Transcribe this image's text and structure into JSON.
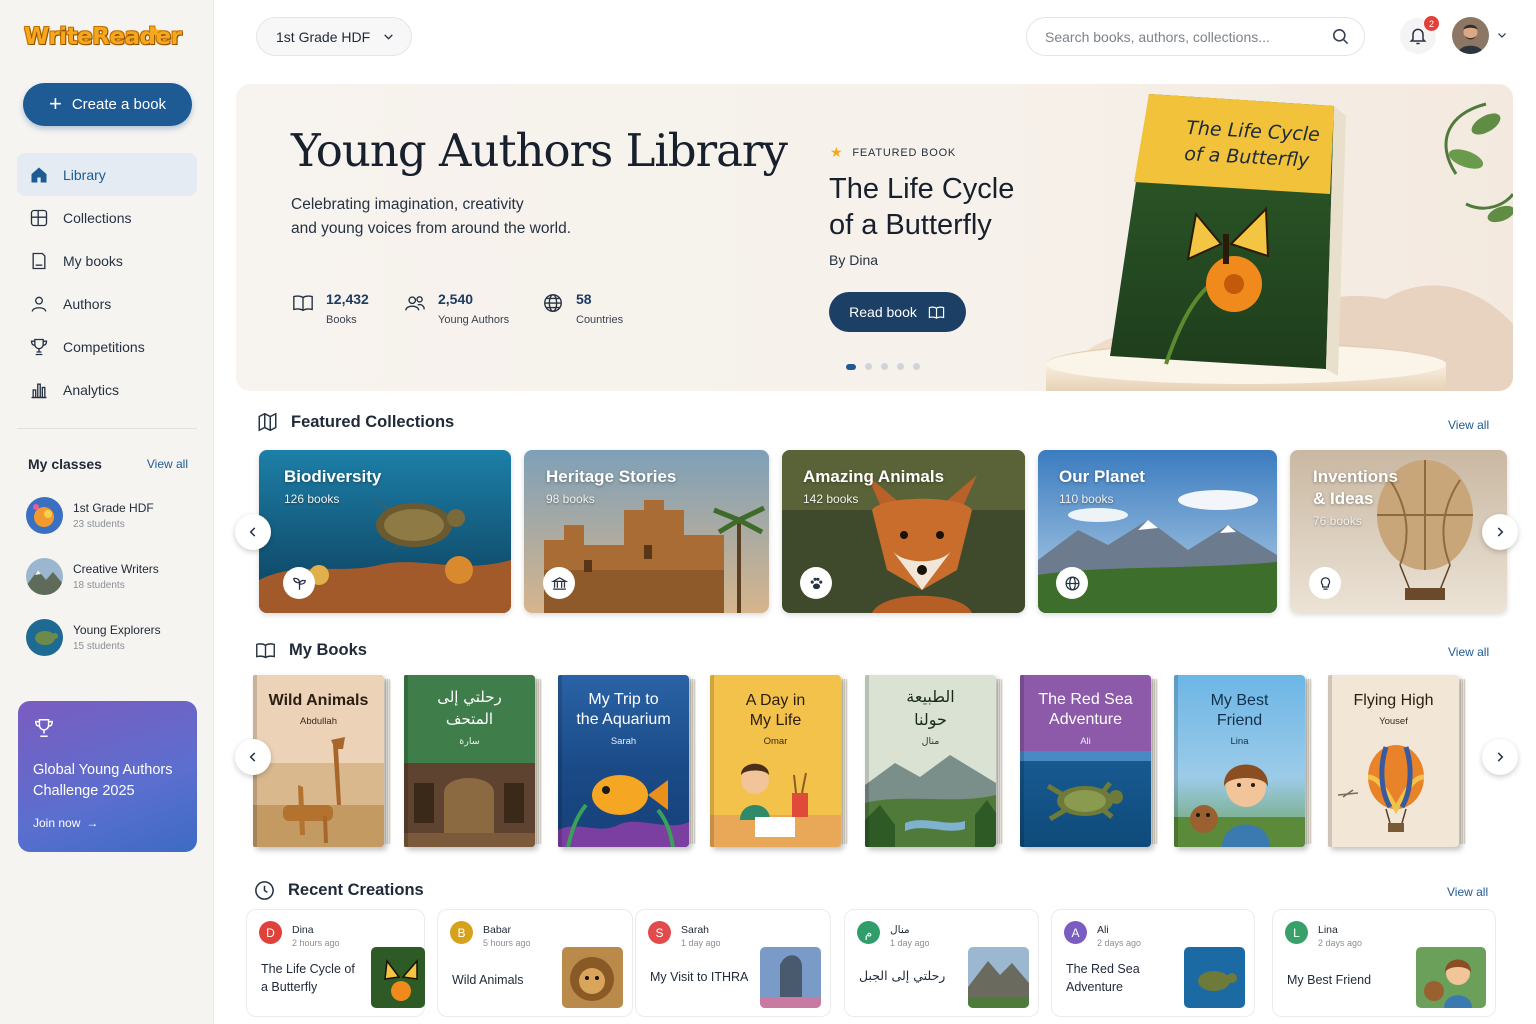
{
  "sidebar": {
    "logo": "WriteReader",
    "create_label": "Create a book",
    "nav": [
      {
        "label": "Library",
        "icon": "home-icon"
      },
      {
        "label": "Collections",
        "icon": "collections-icon"
      },
      {
        "label": "My books",
        "icon": "book-icon"
      },
      {
        "label": "Authors",
        "icon": "user-icon"
      },
      {
        "label": "Competitions",
        "icon": "trophy-icon"
      },
      {
        "label": "Analytics",
        "icon": "bar-chart-icon"
      }
    ],
    "classes_title": "My classes",
    "classes_link": "View all",
    "classes": [
      {
        "name": "1st Grade HDF",
        "students": "23 students"
      },
      {
        "name": "Creative Writers",
        "students": "18 students"
      },
      {
        "name": "Young Explorers",
        "students": "15 students"
      }
    ],
    "promo": {
      "title": "Global Young Authors Challenge 2025",
      "link": "Join now"
    }
  },
  "topbar": {
    "grade": "1st Grade HDF",
    "search_placeholder": "Search books, authors, collections...",
    "notifications": "2"
  },
  "hero": {
    "title": "Young Authors Library",
    "subtitle_line1": "Celebrating imagination, creativity",
    "subtitle_line2": "and young voices from around the world.",
    "stats": [
      {
        "value": "12,432",
        "label": "Books"
      },
      {
        "value": "2,540",
        "label": "Young Authors"
      },
      {
        "value": "58",
        "label": "Countries"
      }
    ],
    "featured_tag": "FEATURED BOOK",
    "featured_title_line1": "The Life Cycle",
    "featured_title_line2": "of a Butterfly",
    "featured_author": "By Dina",
    "read_label": "Read book",
    "cover_title_line1": "The Life Cycle",
    "cover_title_line2": "of a Butterfly"
  },
  "featured_collections": {
    "title": "Featured Collections",
    "link": "View all",
    "items": [
      {
        "name": "Biodiversity",
        "count": "126 books",
        "icon": "sprout-icon"
      },
      {
        "name": "Heritage Stories",
        "count": "98 books",
        "icon": "museum-icon"
      },
      {
        "name": "Amazing Animals",
        "count": "142 books",
        "icon": "paw-icon"
      },
      {
        "name": "Our Planet",
        "count": "110 books",
        "icon": "globe-icon"
      },
      {
        "name_line1": "Inventions",
        "name_line2": "& Ideas",
        "count": "76 books",
        "icon": "lightbulb-icon"
      }
    ]
  },
  "my_books": {
    "title": "My Books",
    "link": "View all",
    "items": [
      {
        "title_line1": "Wild Animals",
        "title_line2": "",
        "author": "Abdullah"
      },
      {
        "title_line1": "رحلتي إلى",
        "title_line2": "المتحف",
        "author": "سارة"
      },
      {
        "title_line1": "My Trip to",
        "title_line2": "the Aquarium",
        "author": "Sarah"
      },
      {
        "title_line1": "A Day in",
        "title_line2": "My Life",
        "author": "Omar"
      },
      {
        "title_line1": "الطبيعة",
        "title_line2": "حولنا",
        "author": "منال"
      },
      {
        "title_line1": "The Red Sea",
        "title_line2": "Adventure",
        "author": "Ali"
      },
      {
        "title_line1": "My Best",
        "title_line2": "Friend",
        "author": "Lina"
      },
      {
        "title_line1": "Flying High",
        "title_line2": "",
        "author": "Yousef"
      }
    ]
  },
  "recent": {
    "title": "Recent Creations",
    "link": "View all",
    "items": [
      {
        "initial": "D",
        "name": "Dina",
        "time": "2 hours ago",
        "title": "The Life Cycle of a Butterfly",
        "color": "#e0413a"
      },
      {
        "initial": "B",
        "name": "Babar",
        "time": "5 hours ago",
        "title": "Wild Animals",
        "color": "#d6a21c"
      },
      {
        "initial": "S",
        "name": "Sarah",
        "time": "1 day ago",
        "title": "My Visit to ITHRA",
        "color": "#e24b4b"
      },
      {
        "initial": "م",
        "name": "منال",
        "time": "1 day ago",
        "title": "رحلتي إلى الجبل",
        "color": "#2f9e6a"
      },
      {
        "initial": "A",
        "name": "Ali",
        "time": "2 days ago",
        "title": "The Red Sea Adventure",
        "color": "#7b5cc0"
      },
      {
        "initial": "L",
        "name": "Lina",
        "time": "2 days ago",
        "title": "My Best Friend",
        "color": "#38a169"
      }
    ]
  }
}
